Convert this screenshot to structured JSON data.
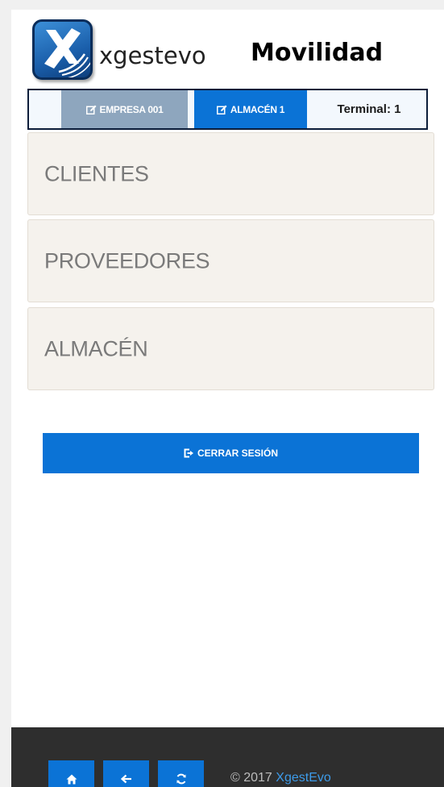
{
  "header": {
    "brand_name": "xgestevo",
    "brand_title": "Movilidad"
  },
  "topbar": {
    "empresa_label": "EMPRESA 001",
    "almacen_label": "ALMACÉN 1",
    "terminal_label": "Terminal: 1"
  },
  "menu": {
    "items": [
      {
        "label": "CLIENTES"
      },
      {
        "label": "PROVEEDORES"
      },
      {
        "label": "ALMACÉN"
      }
    ]
  },
  "logout": {
    "label": "CERRAR SESIÓN"
  },
  "footer": {
    "copyright": "© 2017",
    "brand_link": "XgestEvo",
    "icons": [
      "home-icon",
      "arrow-left-icon",
      "refresh-icon"
    ]
  },
  "colors": {
    "primary": "#0b73d6",
    "empresa": "#8ea6be",
    "footer_bg": "#2e2e2e",
    "link": "#3d9be9"
  }
}
